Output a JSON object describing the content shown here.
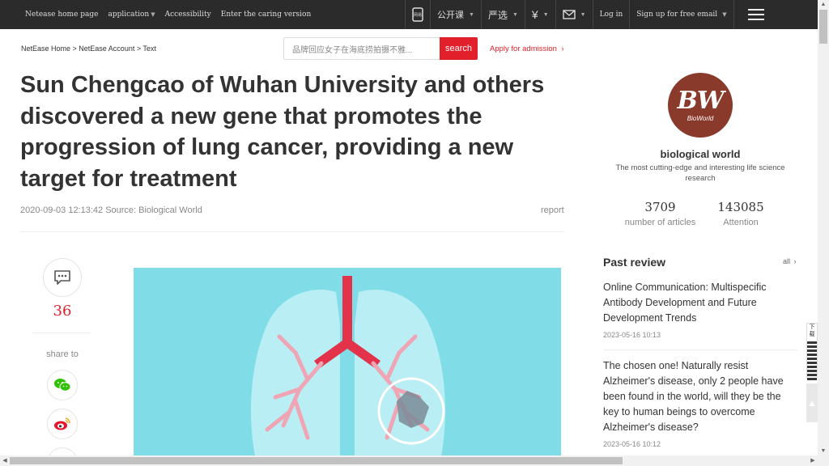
{
  "topbar": {
    "links": [
      {
        "label": "Netease home page"
      },
      {
        "label": "application"
      },
      {
        "label": "Accessibility"
      },
      {
        "label": "Enter the caring version"
      }
    ],
    "mobile_label": "网易",
    "open_course": "公开课",
    "yanxuan": "严选",
    "currency_glyph": "¥",
    "login": "Log in",
    "signup": "Sign up for free email"
  },
  "breadcrumb": "NetEase Home > NetEase Account > Text",
  "search": {
    "placeholder": "品牌回应女子在海底捞拍摄不雅...",
    "button": "search"
  },
  "apply": "Apply for admission",
  "article": {
    "title": "Sun Chengcao of Wuhan University and others discovered a new gene that promotes the progression of lung cancer, providing a new target for treatment",
    "meta": "2020-09-03 12:13:42 Source: Biological World",
    "report": "report"
  },
  "share": {
    "comment_count": "36",
    "share_label": "share to"
  },
  "sidebar": {
    "logo_text": "BW",
    "logo_sub": "BioWorld",
    "name": "biological world",
    "description": "The most cutting-edge and interesting life science research",
    "stats": [
      {
        "value": "3709",
        "label": "number of articles"
      },
      {
        "value": "143085",
        "label": "Attention"
      }
    ],
    "past_review": {
      "title": "Past review",
      "all": "all",
      "items": [
        {
          "title": "Online Communication: Multispecific Antibody Development and Future Development Trends",
          "date": "2023-05-16 10:13"
        },
        {
          "title": "The chosen one! Naturally resist Alzheimer's disease, only 2 people have been found in the world, will they be the key to human beings to overcome Alzheimer's disease?",
          "date": "2023-05-16 10:12"
        }
      ]
    }
  },
  "floaters": {
    "qr_label": "下载"
  },
  "colors": {
    "accent": "#e2202b",
    "topbar": "#2b2b2b",
    "logo_bg": "#8a3a2b",
    "hero_bg": "#80dde8"
  }
}
